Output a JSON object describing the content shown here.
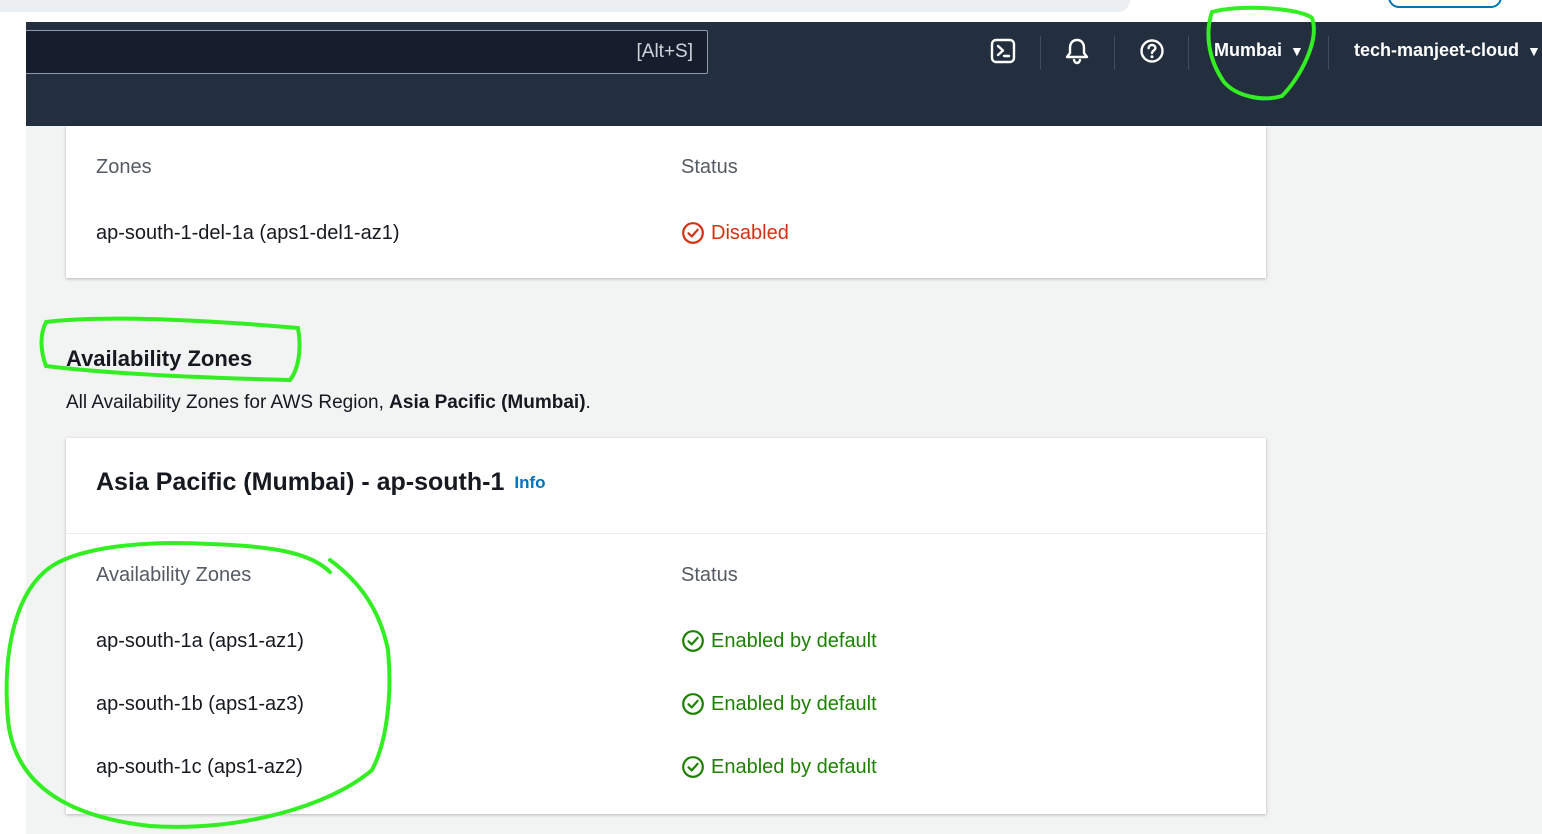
{
  "topnav": {
    "search_shortcut": "[Alt+S]",
    "region_label": "Mumbai",
    "account_label": "tech-manjeet-cloud",
    "icons": [
      "cloudshell-icon",
      "bell-icon",
      "help-icon"
    ],
    "caret": "▼"
  },
  "local_zones": {
    "columns": {
      "zones": "Zones",
      "status": "Status"
    },
    "rows": [
      {
        "zone": "ap-south-1-del-1a (aps1-del1-az1)",
        "status": "Disabled"
      }
    ]
  },
  "availability_zones": {
    "title": "Availability Zones",
    "description_prefix": "All Availability Zones for AWS Region, ",
    "description_region": "Asia Pacific (Mumbai)",
    "description_suffix": ".",
    "panel_title": "Asia Pacific (Mumbai) - ap-south-1",
    "info_link": "Info",
    "columns": {
      "zones": "Availability Zones",
      "status": "Status"
    },
    "rows": [
      {
        "zone": "ap-south-1a (aps1-az1)",
        "status": "Enabled by default"
      },
      {
        "zone": "ap-south-1b (aps1-az3)",
        "status": "Enabled by default"
      },
      {
        "zone": "ap-south-1c (aps1-az2)",
        "status": "Enabled by default"
      }
    ]
  },
  "colors": {
    "nav_background": "#232f3e",
    "status_disabled": "#d13212",
    "status_enabled": "#1d8102",
    "link": "#0073bb",
    "annotation": "#33ee22"
  }
}
